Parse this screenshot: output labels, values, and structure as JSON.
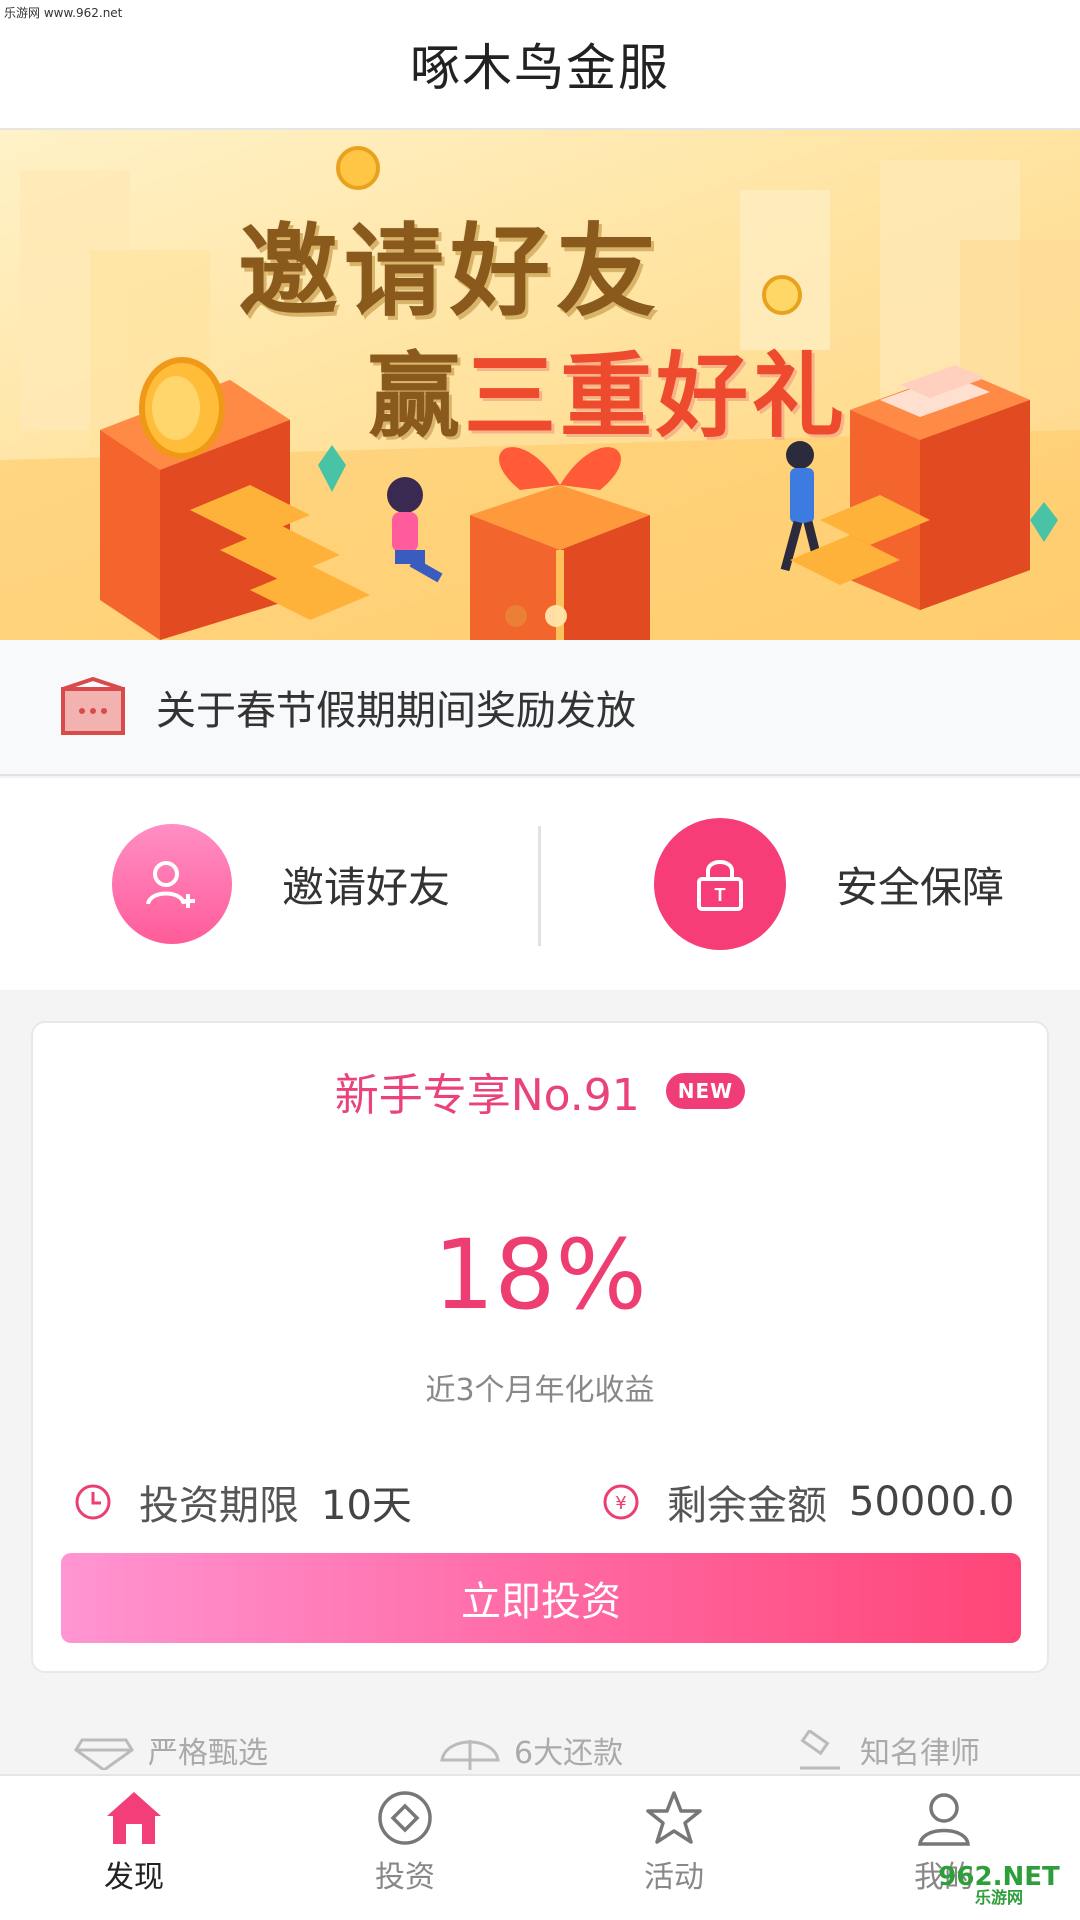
{
  "watermark_top": "乐游网 www.962.net",
  "header": {
    "title": "啄木鸟金服"
  },
  "banner": {
    "line1": "邀请好友",
    "line2_prefix": "赢",
    "line2_highlight": "三重好礼",
    "dots_total": 2,
    "dots_active_index": 1
  },
  "notice": {
    "icon": "message-icon",
    "text": "关于春节假期期间奖励发放"
  },
  "quick": [
    {
      "icon": "add-user-icon",
      "label": "邀请好友",
      "color": "#ff6ea8"
    },
    {
      "icon": "lock-icon",
      "label": "安全保障",
      "color": "#f63d78"
    }
  ],
  "product": {
    "title": "新手专享No.91",
    "badge": "NEW",
    "rate": "18%",
    "rate_label": "近3个月年化收益",
    "term_label": "投资期限",
    "term_value": "10天",
    "remaining_label": "剩余金额",
    "remaining_value": "50000.0",
    "button_label": "立即投资"
  },
  "features": [
    {
      "icon": "diamond-icon",
      "label": "严格甄选"
    },
    {
      "icon": "umbrella-icon",
      "label": "6大还款"
    },
    {
      "icon": "gavel-icon",
      "label": "知名律师"
    }
  ],
  "tabs": [
    {
      "icon": "home-icon",
      "label": "发现",
      "active": true
    },
    {
      "icon": "invest-icon",
      "label": "投资",
      "active": false
    },
    {
      "icon": "star-icon",
      "label": "活动",
      "active": false
    },
    {
      "icon": "user-icon",
      "label": "我的",
      "active": false
    }
  ],
  "watermark_br": {
    "main": "962.NET",
    "sub": "乐游网"
  },
  "colors": {
    "accent": "#ee3d71",
    "pink": "#ff6ea8",
    "banner_brown": "#8a5a1c",
    "banner_red": "#ee4a2e"
  }
}
